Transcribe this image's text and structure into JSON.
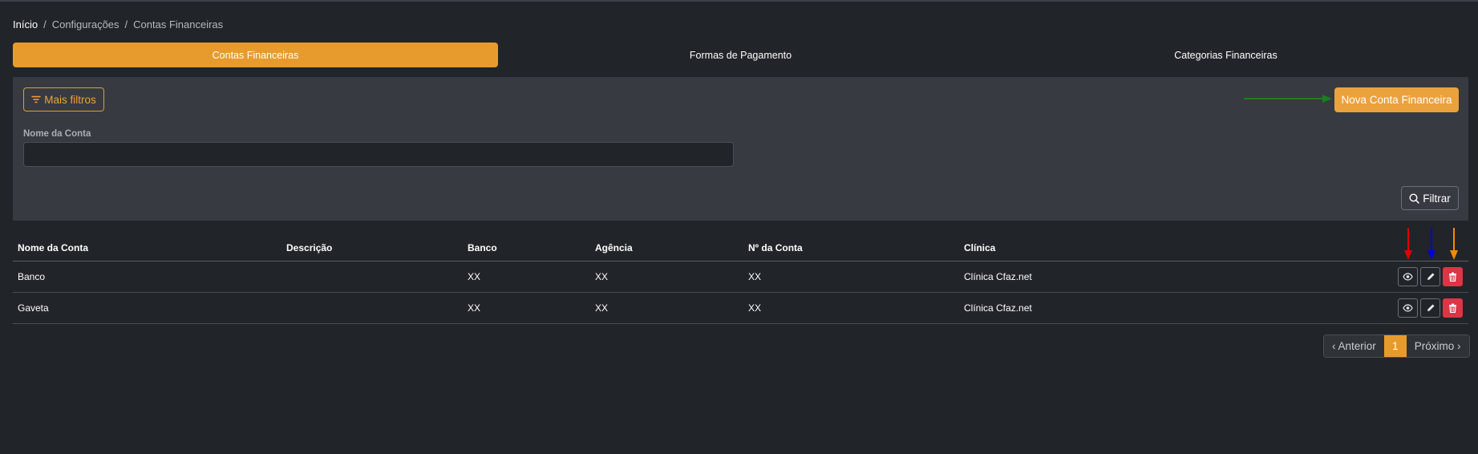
{
  "breadcrumb": [
    "Início",
    "Configurações",
    "Contas Financeiras"
  ],
  "tabs": [
    "Contas Financeiras",
    "Formas de Pagamento",
    "Categorias Financeiras"
  ],
  "filters": {
    "more_filters_label": "Mais filtros",
    "new_account_label": "Nova Conta Financeira",
    "account_name_label": "Nome da Conta",
    "account_name_value": "",
    "filter_button_label": "Filtrar"
  },
  "table": {
    "columns": [
      "Nome da Conta",
      "Descrição",
      "Banco",
      "Agência",
      "Nº da Conta",
      "Clínica"
    ],
    "rows": [
      {
        "name": "Banco",
        "description": "",
        "bank": "XX",
        "agency": "XX",
        "number": "XX",
        "clinic": "Clínica Cfaz.net"
      },
      {
        "name": "Gaveta",
        "description": "",
        "bank": "XX",
        "agency": "XX",
        "number": "XX",
        "clinic": "Clínica Cfaz.net"
      }
    ],
    "actions": [
      "eye-icon",
      "pencil-icon",
      "trash-icon"
    ]
  },
  "pagination": {
    "previous_label": "‹ Anterior",
    "current_page": "1",
    "next_label": "Próximo ›"
  },
  "colors": {
    "accent": "#e89b2d",
    "background": "#212429",
    "panel": "#373a40",
    "danger": "#dc3545",
    "annotation_green": "#1a7f1a",
    "annotation_red": "#e00000",
    "annotation_blue": "#0000dd",
    "annotation_orange": "#f08c00"
  }
}
